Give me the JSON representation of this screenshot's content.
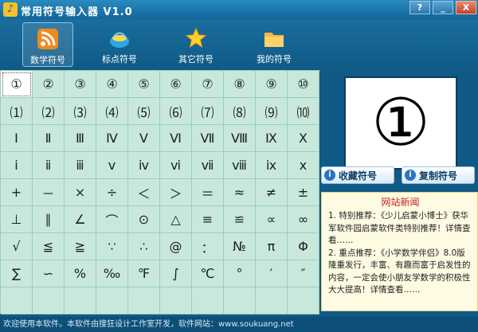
{
  "window": {
    "title": "常用符号输入器 V1.0",
    "buttons": {
      "help": "?",
      "minimize": "_",
      "close": "X"
    }
  },
  "toolbar": {
    "tabs": [
      {
        "label": "数学符号",
        "icon": "rss-feed-icon",
        "active": true
      },
      {
        "label": "标点符号",
        "icon": "basket-icon",
        "active": false
      },
      {
        "label": "其它符号",
        "icon": "star-icon",
        "active": false
      },
      {
        "label": "我的符号",
        "icon": "folder-icon",
        "active": false
      }
    ]
  },
  "symbols": [
    [
      "①",
      "②",
      "③",
      "④",
      "⑤",
      "⑥",
      "⑦",
      "⑧",
      "⑨",
      "⑩"
    ],
    [
      "⑴",
      "⑵",
      "⑶",
      "⑷",
      "⑸",
      "⑹",
      "⑺",
      "⑻",
      "⑼",
      "⑽"
    ],
    [
      "Ⅰ",
      "Ⅱ",
      "Ⅲ",
      "Ⅳ",
      "Ⅴ",
      "Ⅵ",
      "Ⅶ",
      "Ⅷ",
      "Ⅸ",
      "Ⅹ"
    ],
    [
      "ⅰ",
      "ⅱ",
      "ⅲ",
      "ⅴ",
      "ⅳ",
      "ⅵ",
      "ⅶ",
      "ⅷ",
      "ⅸ",
      "ⅹ"
    ],
    [
      "+",
      "－",
      "×",
      "÷",
      "＜",
      "＞",
      "＝",
      "≈",
      "≠",
      "±"
    ],
    [
      "⊥",
      "∥",
      "∠",
      "⌒",
      "⊙",
      "△",
      "≡",
      "≌",
      "∝",
      "∞"
    ],
    [
      "√",
      "≦",
      "≧",
      "∵",
      "∴",
      "@",
      "：",
      "№",
      "π",
      "Φ"
    ],
    [
      "∑",
      "∽",
      "%",
      "‰",
      "℉",
      "∫",
      "℃",
      "°",
      "′",
      "″"
    ]
  ],
  "preview": {
    "symbol": "①"
  },
  "actions": {
    "favorite": "收藏符号",
    "copy": "复制符号"
  },
  "news": {
    "title": "网站新闻",
    "items": [
      "1.   特别推荐：《少儿启蒙小博士》获华军软件园启蒙软件类特别推荐！详情查看……",
      "2.   重点推荐：《小学数学伴侣》8.0版隆重发行，丰富、有趣而富于启发性的内容，一定会使小朋友学数学的积极性大大提高！详情查看……"
    ]
  },
  "status": {
    "text": "欢迎使用本软件。本软件由搜狂设计工作室开发，软件网站：www.soukuang.net"
  },
  "colors": {
    "window_bg": "#0f5a86",
    "grid_bg": "#c9e8dc",
    "grid_line": "#9ccdb9",
    "news_title": "#c81e1e"
  }
}
